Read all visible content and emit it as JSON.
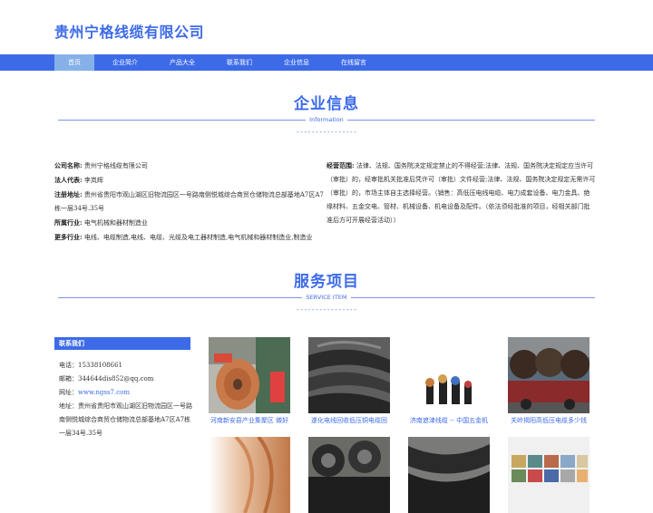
{
  "site": {
    "title": "贵州宁格线缆有限公司"
  },
  "nav": [
    {
      "label": "首页",
      "active": true
    },
    {
      "label": "企业简介"
    },
    {
      "label": "产品大全"
    },
    {
      "label": "联系我们"
    },
    {
      "label": "企业信息"
    },
    {
      "label": "在线留言"
    }
  ],
  "info_section": {
    "title": "企业信息",
    "subtitle": "Information",
    "dashes": "----------------"
  },
  "company": {
    "name_label": "公司名称:",
    "name": "贵州宁格线缆有限公司",
    "rep_label": "法人代表:",
    "rep": "李岚辉",
    "addr_label": "注册地址:",
    "addr": "贵州省贵阳市观山湖区旧物流园区一号路南侧悦城综合商贸仓储物流总部基地A7区A7栋一层34号.35号",
    "industry_label": "所属行业:",
    "industry": "电气机械和器材制造业",
    "more_label": "更多行业:",
    "more": "电线、电缆制造,电线、电缆、光缆及电工器材制造,电气机械和器材制造业,制造业",
    "scope_label": "经营范围:",
    "scope": "法律、法规、国务院决定规定禁止的不得经营;法律、法规、国务院决定规定应当许可（审批）的，经审批机关批准后凭许可（审批）文件经营;法律、法规、国务院决定规定无需许可（审批）的，市场主体自主选择经营。（销售：高低压电线电缆、电力成套设备、电力金具、绝缘材料、五金交电、管材、机械设备、机电设备及配件。（依法须经批准的项目，经相关部门批准后方可开展经营活动））"
  },
  "service_section": {
    "title": "服务项目",
    "subtitle": "SERVICE ITEM",
    "dashes": "----------------"
  },
  "contact": {
    "heading": "联系我们",
    "phone_label": "电话：",
    "phone": "15338108661",
    "email_label": "邮箱：",
    "email": "344644dis852@qq.com",
    "web_label": "网址：",
    "web": "www.ngss7.com",
    "addr_label": "地址：",
    "addr": "贵州省贵阳市观山湖区旧物流园区一号路南侧悦城综合商贸仓储物流总部基地A7区A7栋一层34号.35号"
  },
  "products": [
    {
      "caption": "河南新安县产业集聚区 做好",
      "image": "copper-wire-spools"
    },
    {
      "caption": "遂化电线回收低压铜电缆回",
      "image": "cable-bundles"
    },
    {
      "caption": "济南遮津线缆 -- 中国五金机",
      "image": "cable-cross-sections"
    },
    {
      "caption": "关岭揭阳高低压电缆多少钱",
      "image": "cable-drums-truck"
    },
    {
      "caption": "",
      "image": "copper-coil"
    },
    {
      "caption": "",
      "image": "cable-coils"
    },
    {
      "caption": "",
      "image": "black-cables"
    },
    {
      "caption": "",
      "image": "color-blocks"
    }
  ],
  "colors": {
    "brand": "#3d6be8",
    "nav_active": "#86b1e8"
  }
}
